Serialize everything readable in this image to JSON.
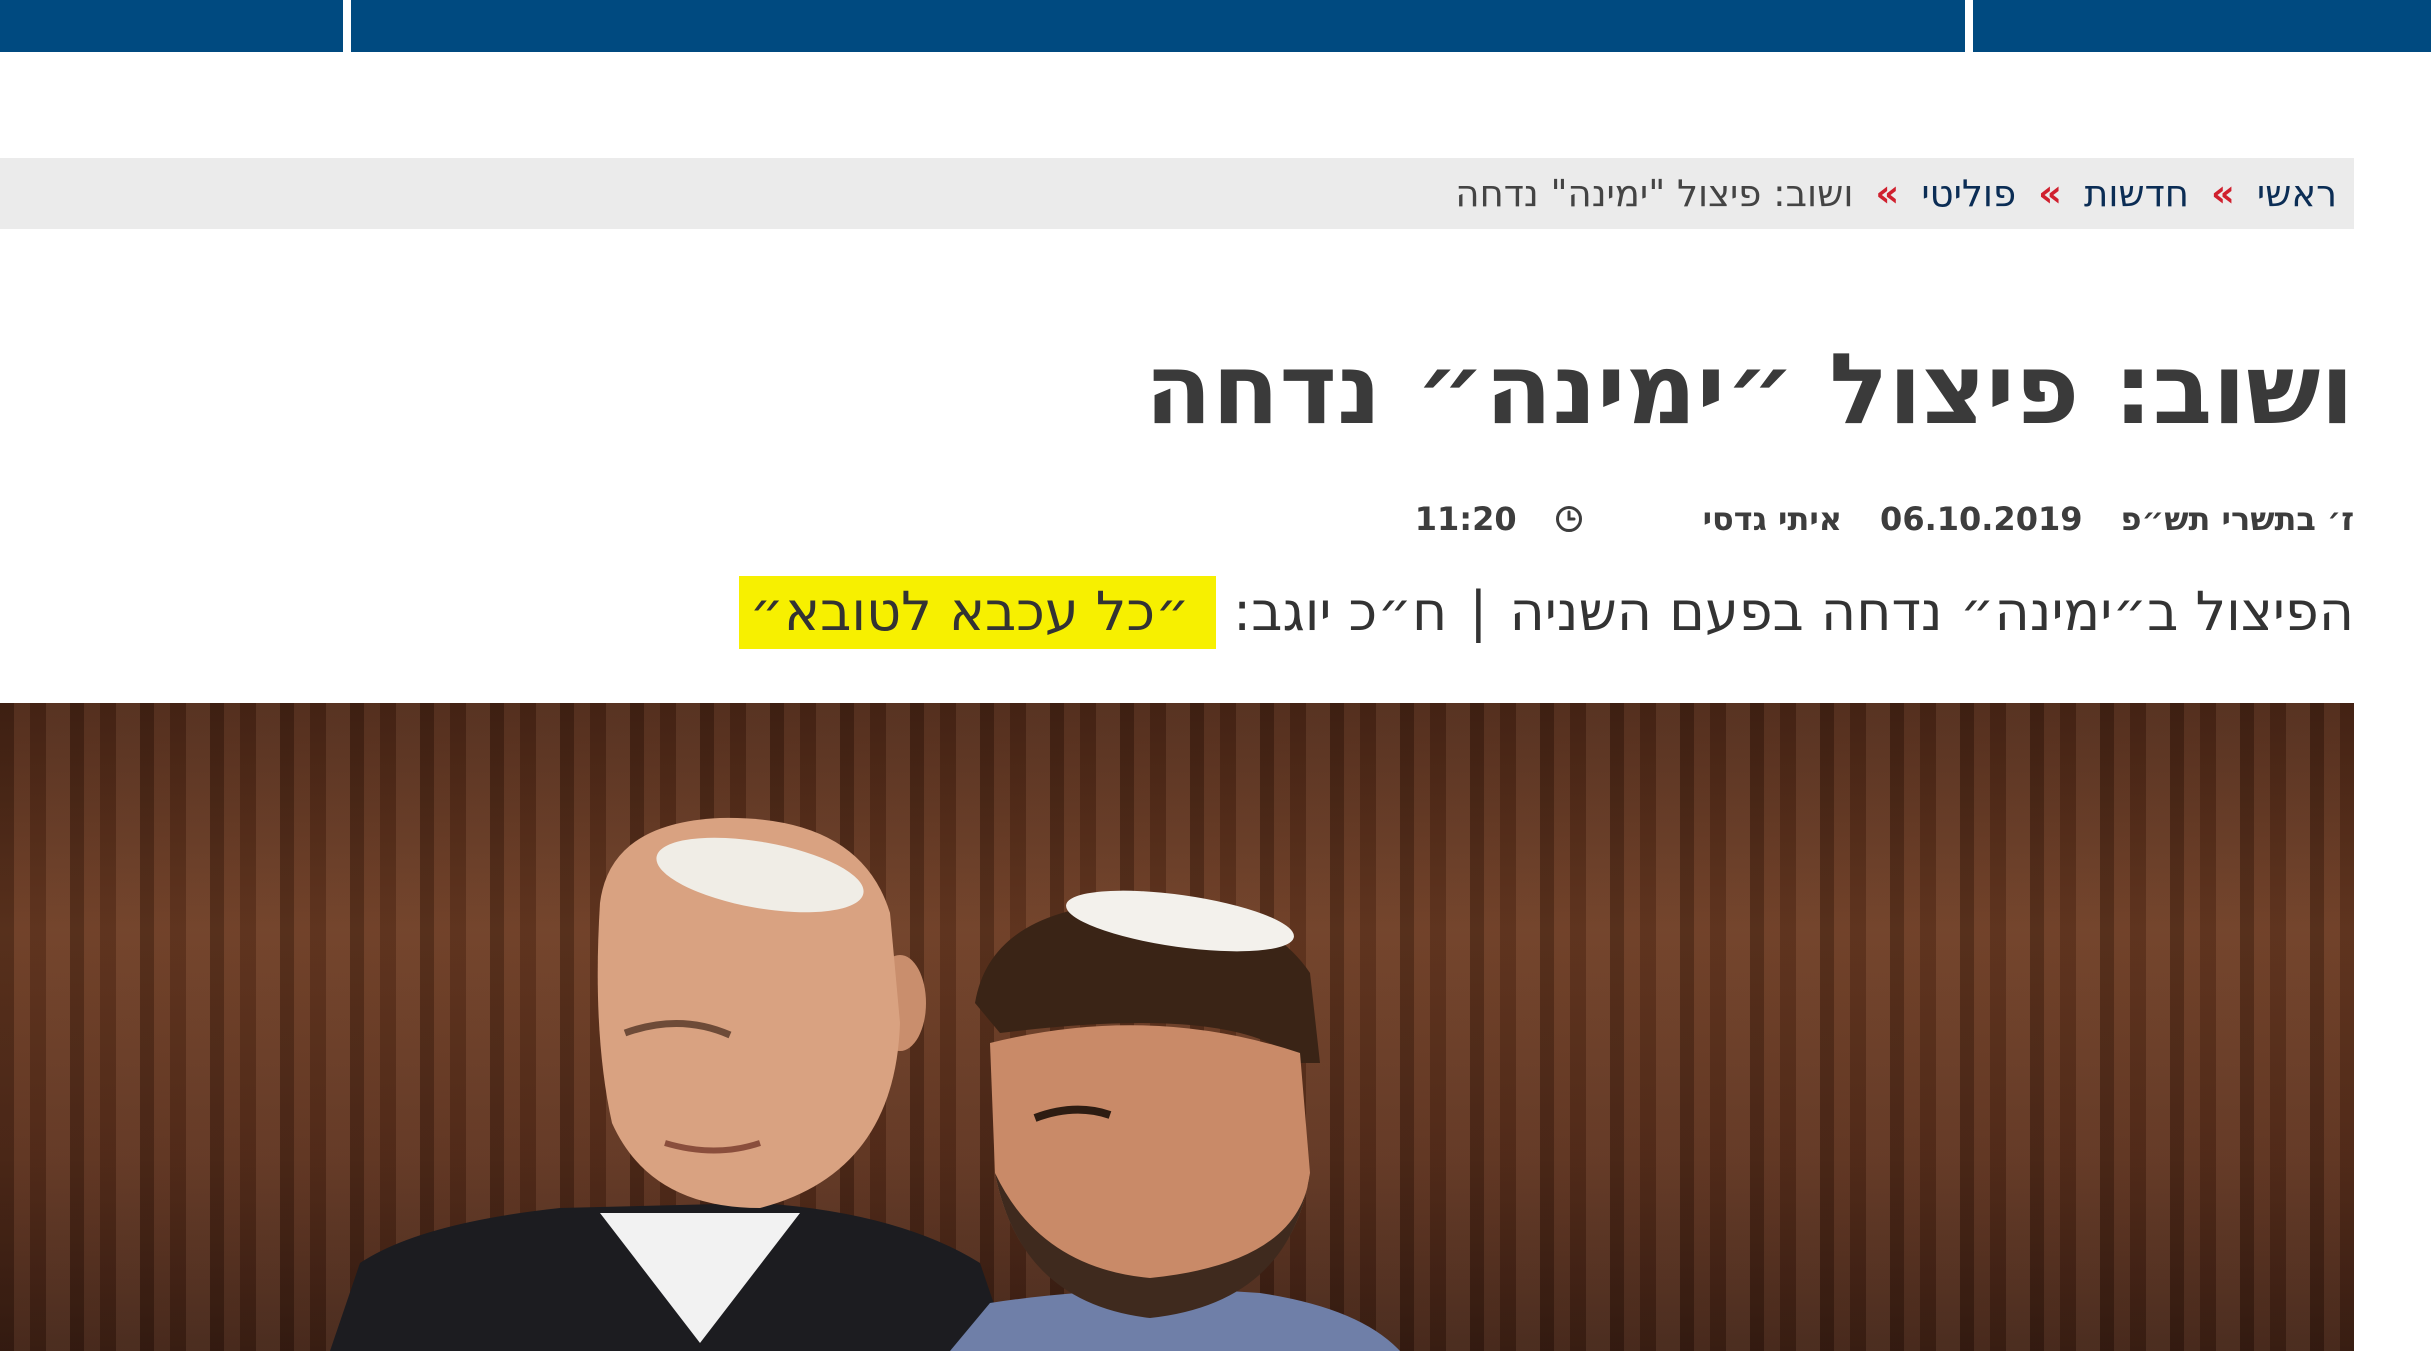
{
  "breadcrumb": {
    "items": [
      "ראשי",
      "חדשות",
      "פוליטי"
    ],
    "separator": "»",
    "current": "ושוב: פיצול \"ימינה\" נדחה"
  },
  "article": {
    "title": "ושוב: פיצול ״ימינה״ נדחה",
    "hebrew_date": "ז׳ בתשרי תש״פ",
    "date": "06.10.2019",
    "author": "איתי גדסי",
    "time": "11:20",
    "subtitle_main": "הפיצול ב״ימינה״ נדחה בפעם השניה",
    "subtitle_divider": "|",
    "subtitle_speaker": "ח״כ יוגב:",
    "subtitle_quote": "״כל עכבא לטובא״"
  },
  "colors": {
    "nav": "#004a80",
    "breadcrumb_bg": "#ebebeb",
    "breadcrumb_sep": "#d0202e",
    "highlight": "#f7f000"
  },
  "icons": {
    "time": "clock-icon"
  }
}
